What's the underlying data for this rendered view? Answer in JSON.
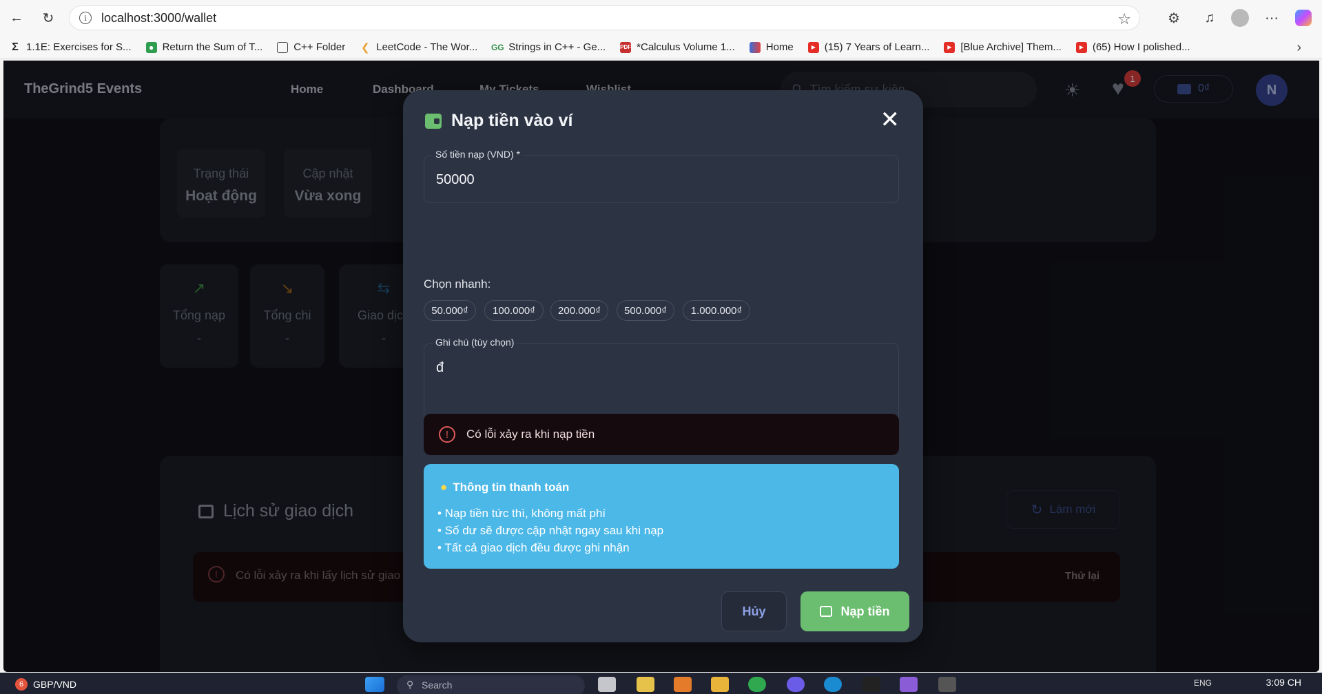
{
  "browser": {
    "url": "localhost:3000/wallet",
    "bookmarks": [
      "1.1E: Exercises for S...",
      "Return the Sum of T...",
      "C++ Folder",
      "LeetCode - The Wor...",
      "Strings in C++ - Ge...",
      "*Calculus Volume 1...",
      "Home",
      "(15) 7 Years of Learn...",
      "[Blue Archive] Them...",
      "(65) How I polished..."
    ]
  },
  "header": {
    "brand": "TheGrind5 Events",
    "nav": [
      "Home",
      "Dashboard",
      "My Tickets",
      "Wishlist"
    ],
    "search_placeholder": "Tìm kiếm sự kiện...",
    "wishlist_count": "1",
    "wallet_balance": "0₫",
    "avatar_initial": "N"
  },
  "wallet_card": {
    "status_label": "Trạng thái",
    "status_value": "Hoạt động",
    "updated_label": "Cập nhật",
    "updated_value": "Vừa xong"
  },
  "stats": [
    {
      "label": "Tổng nạp",
      "value": "-"
    },
    {
      "label": "Tổng chi",
      "value": "-"
    },
    {
      "label": "Giao dịch",
      "value": "-"
    }
  ],
  "history": {
    "title": "Lịch sử giao dịch",
    "refresh": "Làm mới",
    "error": "Có lỗi xảy ra khi lấy lịch sử giao",
    "retry": "Thử lại"
  },
  "modal": {
    "title": "Nạp tiền vào ví",
    "amount_label": "Số tiền nạp (VND) *",
    "amount_value": "50000",
    "quick_label": "Chọn nhanh:",
    "quick_options": [
      "50.000₫",
      "100.000₫",
      "200.000₫",
      "500.000₫",
      "1.000.000₫"
    ],
    "note_label": "Ghi chú (tùy chọn)",
    "note_value": "đ",
    "error": "Có lỗi xảy ra khi nạp tiền",
    "info_title": "Thông tin thanh toán",
    "info_lines": [
      "• Nạp tiền tức thì, không mất phí",
      "• Số dư sẽ được cập nhật ngay sau khi nạp",
      "• Tất cả giao dịch đều được ghi nhận"
    ],
    "cancel": "Hủy",
    "submit": "Nạp tiền"
  },
  "taskbar": {
    "weather_badge": "6",
    "ticker": "GBP/VND",
    "search": "Search",
    "lang": "ENG",
    "time": "3:09 CH"
  },
  "colors": {
    "accent_green": "#6bbd6f",
    "info_blue": "#4cb8e8",
    "error_red": "#e05a5a",
    "modal_bg": "#2c3342"
  }
}
